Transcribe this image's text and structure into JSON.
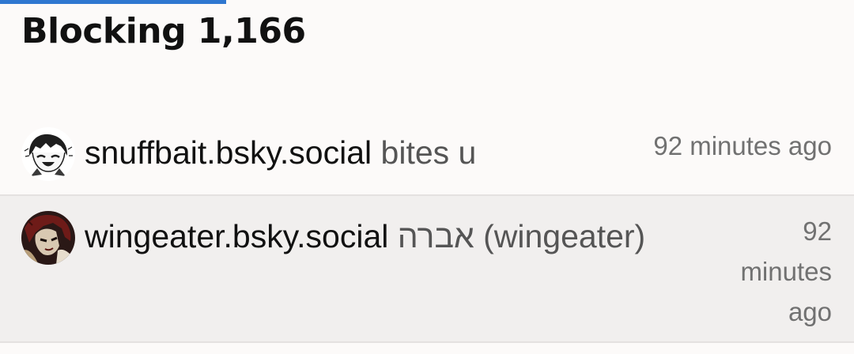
{
  "header": {
    "title": "Blocking 1,166",
    "loading_progress": 0.265
  },
  "blocked_list": [
    {
      "handle": "snuffbait.bsky.social",
      "display_name": "bites u",
      "time": "92 minutes ago",
      "avatar_icon": "anime-avatar-icon"
    },
    {
      "handle": "wingeater.bsky.social",
      "display_name": "אברה (wingeater)",
      "time": "92 minutes ago",
      "avatar_icon": "dark-avatar-icon"
    }
  ],
  "colors": {
    "accent": "#2f77d0",
    "background": "#fcfaf9",
    "highlighted_row": "#f1efee"
  }
}
